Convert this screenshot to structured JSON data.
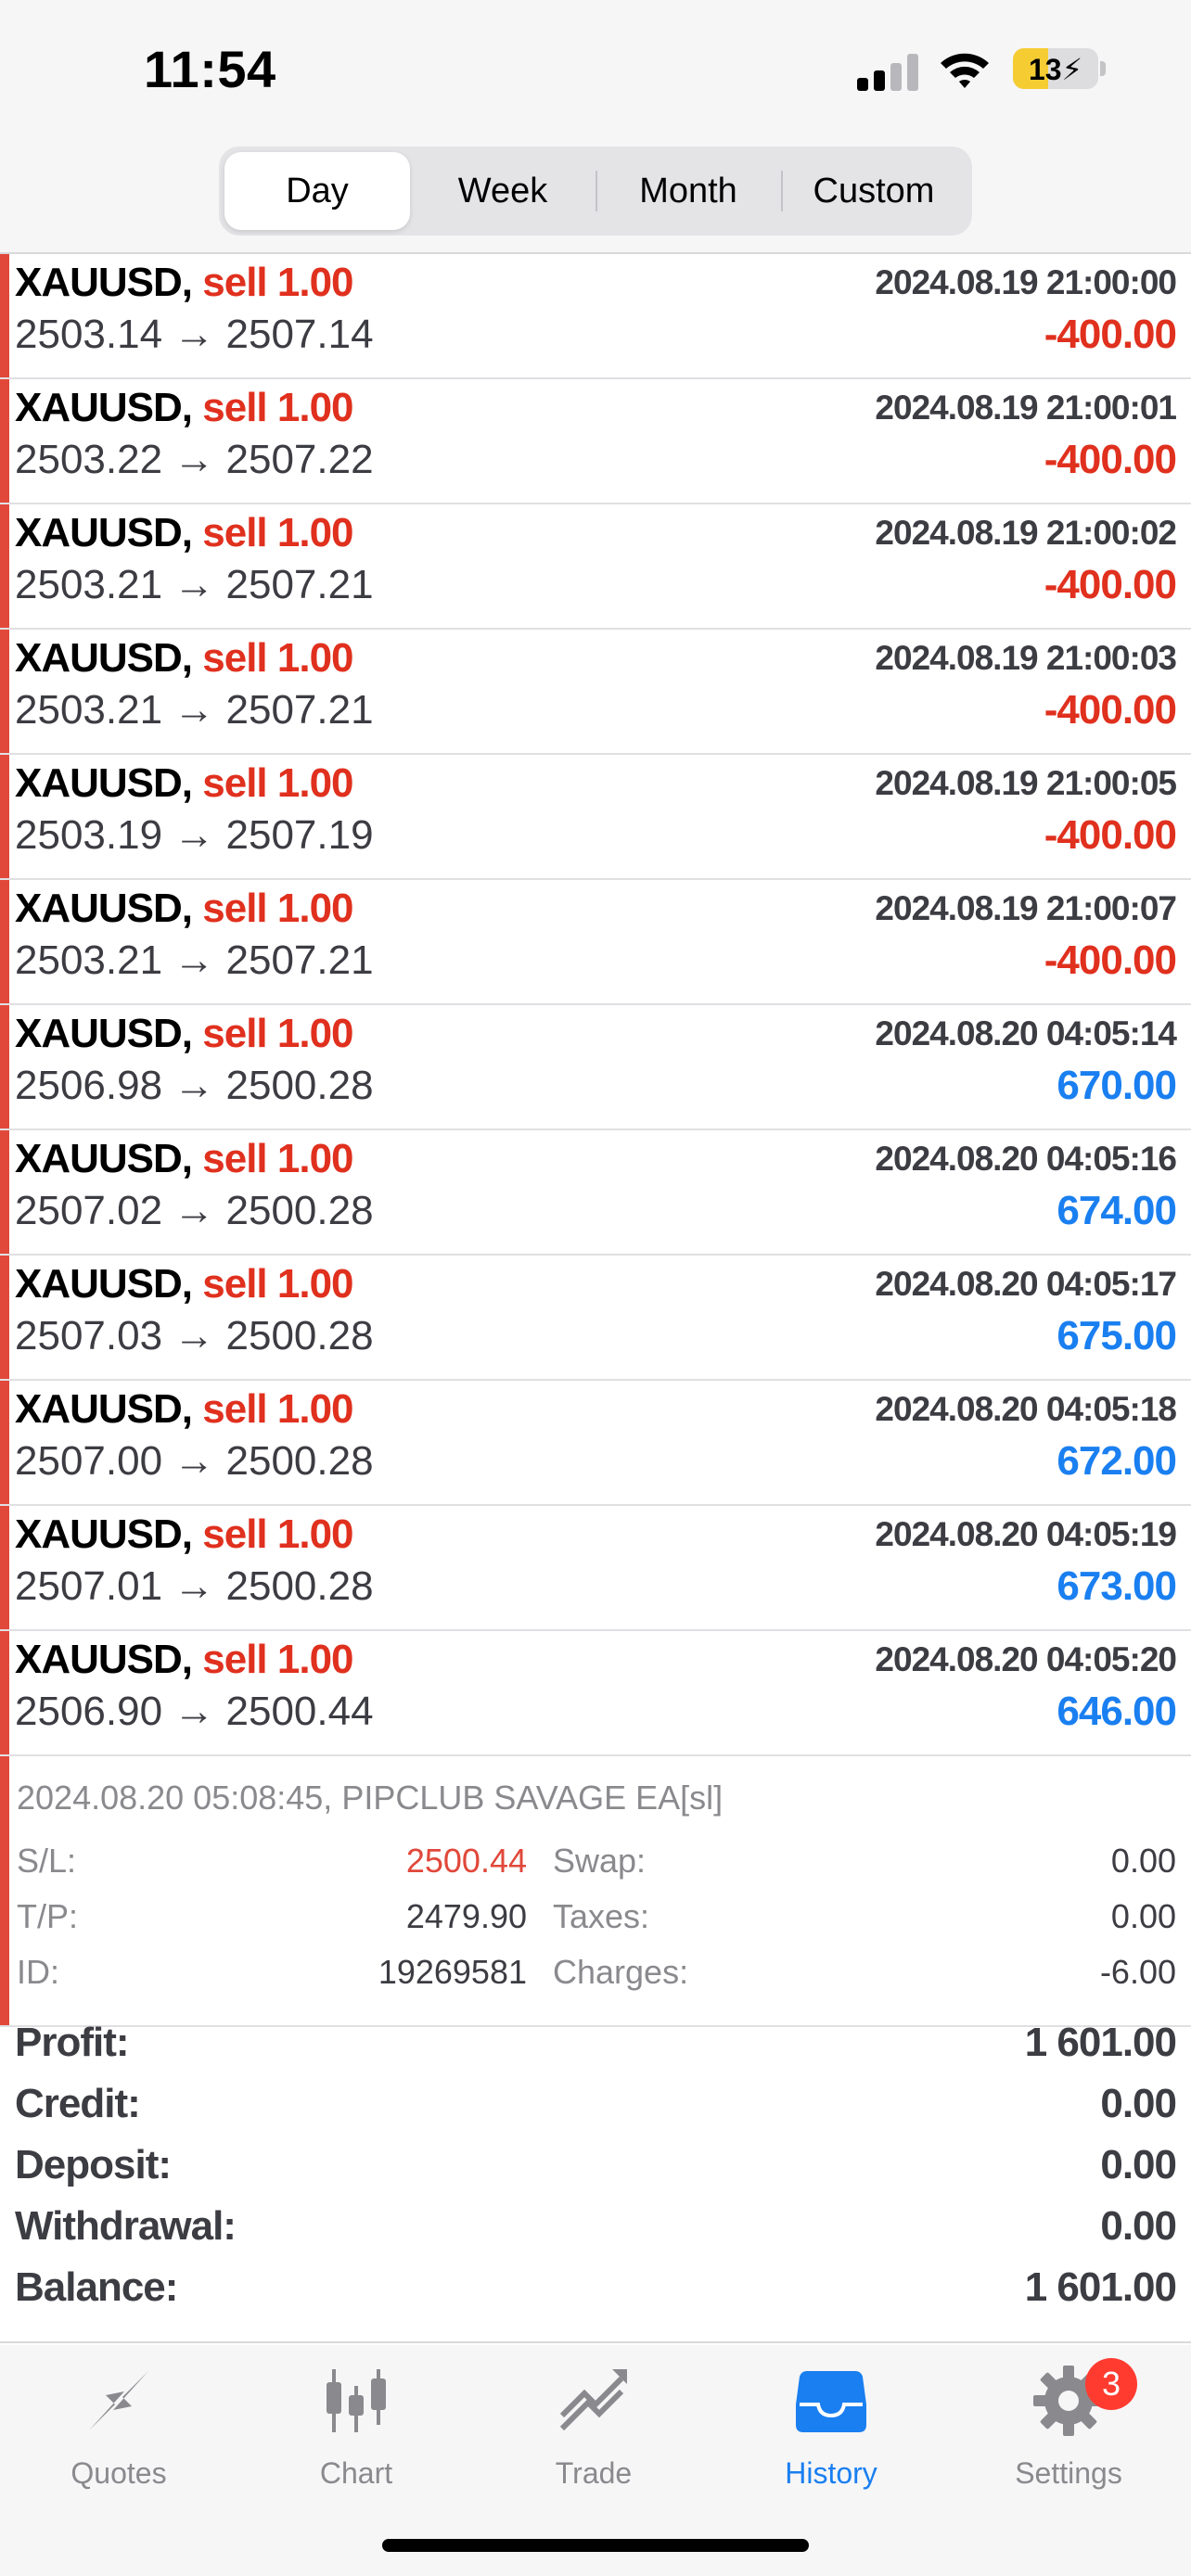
{
  "status_bar": {
    "time": "11:54",
    "battery": "13",
    "battery_level": 0.13
  },
  "range_tabs": [
    {
      "label": "Day",
      "active": true
    },
    {
      "label": "Week",
      "active": false
    },
    {
      "label": "Month",
      "active": false
    },
    {
      "label": "Custom",
      "active": false
    }
  ],
  "deals": [
    {
      "symbol": "XAUUSD,",
      "side": "sell 1.00",
      "time": "2024.08.19 21:00:00",
      "prices": "2503.14 → 2507.14",
      "profit": "-400.00",
      "positive": false
    },
    {
      "symbol": "XAUUSD,",
      "side": "sell 1.00",
      "time": "2024.08.19 21:00:01",
      "prices": "2503.22 → 2507.22",
      "profit": "-400.00",
      "positive": false
    },
    {
      "symbol": "XAUUSD,",
      "side": "sell 1.00",
      "time": "2024.08.19 21:00:02",
      "prices": "2503.21 → 2507.21",
      "profit": "-400.00",
      "positive": false
    },
    {
      "symbol": "XAUUSD,",
      "side": "sell 1.00",
      "time": "2024.08.19 21:00:03",
      "prices": "2503.21 → 2507.21",
      "profit": "-400.00",
      "positive": false
    },
    {
      "symbol": "XAUUSD,",
      "side": "sell 1.00",
      "time": "2024.08.19 21:00:05",
      "prices": "2503.19 → 2507.19",
      "profit": "-400.00",
      "positive": false
    },
    {
      "symbol": "XAUUSD,",
      "side": "sell 1.00",
      "time": "2024.08.19 21:00:07",
      "prices": "2503.21 → 2507.21",
      "profit": "-400.00",
      "positive": false
    },
    {
      "symbol": "XAUUSD,",
      "side": "sell 1.00",
      "time": "2024.08.20 04:05:14",
      "prices": "2506.98 → 2500.28",
      "profit": "670.00",
      "positive": true
    },
    {
      "symbol": "XAUUSD,",
      "side": "sell 1.00",
      "time": "2024.08.20 04:05:16",
      "prices": "2507.02 → 2500.28",
      "profit": "674.00",
      "positive": true
    },
    {
      "symbol": "XAUUSD,",
      "side": "sell 1.00",
      "time": "2024.08.20 04:05:17",
      "prices": "2507.03 → 2500.28",
      "profit": "675.00",
      "positive": true
    },
    {
      "symbol": "XAUUSD,",
      "side": "sell 1.00",
      "time": "2024.08.20 04:05:18",
      "prices": "2507.00 → 2500.28",
      "profit": "672.00",
      "positive": true
    },
    {
      "symbol": "XAUUSD,",
      "side": "sell 1.00",
      "time": "2024.08.20 04:05:19",
      "prices": "2507.01 → 2500.28",
      "profit": "673.00",
      "positive": true
    },
    {
      "symbol": "XAUUSD,",
      "side": "sell 1.00",
      "time": "2024.08.20 04:05:20",
      "prices": "2506.90 → 2500.44",
      "profit": "646.00",
      "positive": true
    }
  ],
  "detail": {
    "meta": "2024.08.20 05:08:45, PIPCLUB SAVAGE EA[sl]",
    "sl_label": "S/L:",
    "sl_value": "2500.44",
    "tp_label": "T/P:",
    "tp_value": "2479.90",
    "id_label": "ID:",
    "id_value": "19269581",
    "swap_label": "Swap:",
    "swap_value": "0.00",
    "taxes_label": "Taxes:",
    "taxes_value": "0.00",
    "charges_label": "Charges:",
    "charges_value": "-6.00"
  },
  "summary": [
    {
      "label": "Profit:",
      "value": "1 601.00"
    },
    {
      "label": "Credit:",
      "value": "0.00"
    },
    {
      "label": "Deposit:",
      "value": "0.00"
    },
    {
      "label": "Withdrawal:",
      "value": "0.00"
    },
    {
      "label": "Balance:",
      "value": "1 601.00"
    }
  ],
  "tabbar": [
    {
      "label": "Quotes",
      "icon": "quotes-icon",
      "active": false
    },
    {
      "label": "Chart",
      "icon": "candlestick-chart-icon",
      "active": false
    },
    {
      "label": "Trade",
      "icon": "trade-icon",
      "active": false
    },
    {
      "label": "History",
      "icon": "history-tray-icon",
      "active": true
    },
    {
      "label": "Settings",
      "icon": "gear-icon",
      "active": false,
      "badge": "3"
    }
  ],
  "colors": {
    "loss": "#e0301e",
    "profit": "#1a7ff0",
    "accent": "#1a7ff0",
    "side_bar": "#e2483a"
  }
}
